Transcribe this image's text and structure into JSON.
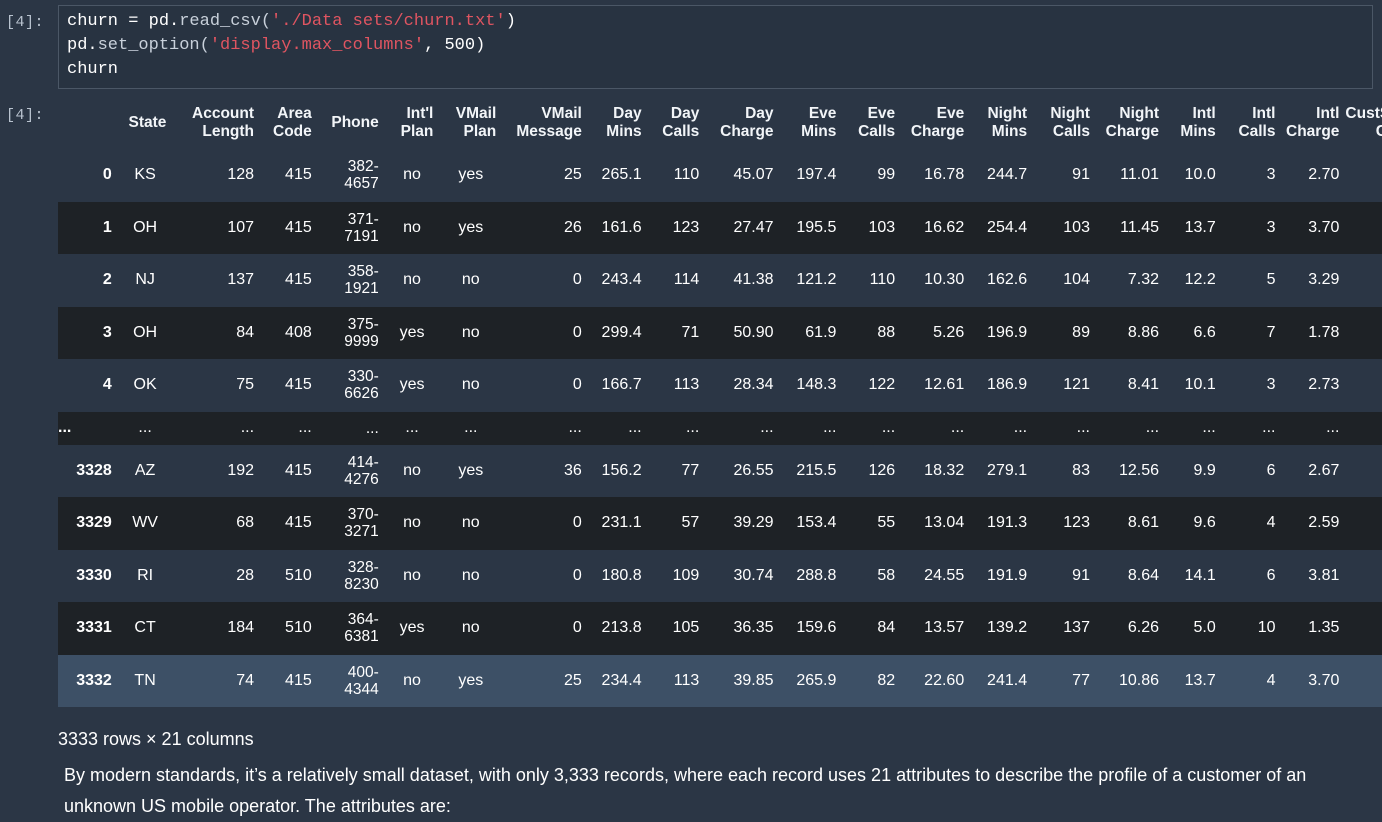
{
  "cell": {
    "in_prompt": "[4]:",
    "out_prompt": "[4]:",
    "code": [
      [
        {
          "t": "churn = pd.",
          "c": ""
        },
        {
          "t": "read_csv(",
          "c": "fn"
        },
        {
          "t": "'./Data sets/churn.txt'",
          "c": "str"
        },
        {
          "t": ")",
          "c": ""
        }
      ],
      [
        {
          "t": "pd.",
          "c": ""
        },
        {
          "t": "set_option(",
          "c": "fn"
        },
        {
          "t": "'display.max_columns'",
          "c": "str"
        },
        {
          "t": ", 500)",
          "c": ""
        }
      ],
      [
        {
          "t": "churn",
          "c": ""
        }
      ]
    ]
  },
  "table": {
    "columns": [
      "",
      "State",
      "Account Length",
      "Area Code",
      "Phone",
      "Int'l Plan",
      "VMail Plan",
      "VMail Message",
      "Day Mins",
      "Day Calls",
      "Day Charge",
      "Eve Mins",
      "Eve Calls",
      "Eve Charge",
      "Night Mins",
      "Night Calls",
      "Night Charge",
      "Intl Mins",
      "Intl Calls",
      "Intl Charge",
      "CustS C"
    ],
    "rows": [
      [
        "0",
        "KS",
        "128",
        "415",
        "382-4657",
        "no",
        "yes",
        "25",
        "265.1",
        "110",
        "45.07",
        "197.4",
        "99",
        "16.78",
        "244.7",
        "91",
        "11.01",
        "10.0",
        "3",
        "2.70",
        ""
      ],
      [
        "1",
        "OH",
        "107",
        "415",
        "371-7191",
        "no",
        "yes",
        "26",
        "161.6",
        "123",
        "27.47",
        "195.5",
        "103",
        "16.62",
        "254.4",
        "103",
        "11.45",
        "13.7",
        "3",
        "3.70",
        ""
      ],
      [
        "2",
        "NJ",
        "137",
        "415",
        "358-1921",
        "no",
        "no",
        "0",
        "243.4",
        "114",
        "41.38",
        "121.2",
        "110",
        "10.30",
        "162.6",
        "104",
        "7.32",
        "12.2",
        "5",
        "3.29",
        ""
      ],
      [
        "3",
        "OH",
        "84",
        "408",
        "375-9999",
        "yes",
        "no",
        "0",
        "299.4",
        "71",
        "50.90",
        "61.9",
        "88",
        "5.26",
        "196.9",
        "89",
        "8.86",
        "6.6",
        "7",
        "1.78",
        ""
      ],
      [
        "4",
        "OK",
        "75",
        "415",
        "330-6626",
        "yes",
        "no",
        "0",
        "166.7",
        "113",
        "28.34",
        "148.3",
        "122",
        "12.61",
        "186.9",
        "121",
        "8.41",
        "10.1",
        "3",
        "2.73",
        ""
      ],
      [
        "...",
        "...",
        "...",
        "...",
        "...",
        "...",
        "...",
        "...",
        "...",
        "...",
        "...",
        "...",
        "...",
        "...",
        "...",
        "...",
        "...",
        "...",
        "...",
        "...",
        ""
      ],
      [
        "3328",
        "AZ",
        "192",
        "415",
        "414-4276",
        "no",
        "yes",
        "36",
        "156.2",
        "77",
        "26.55",
        "215.5",
        "126",
        "18.32",
        "279.1",
        "83",
        "12.56",
        "9.9",
        "6",
        "2.67",
        ""
      ],
      [
        "3329",
        "WV",
        "68",
        "415",
        "370-3271",
        "no",
        "no",
        "0",
        "231.1",
        "57",
        "39.29",
        "153.4",
        "55",
        "13.04",
        "191.3",
        "123",
        "8.61",
        "9.6",
        "4",
        "2.59",
        ""
      ],
      [
        "3330",
        "RI",
        "28",
        "510",
        "328-8230",
        "no",
        "no",
        "0",
        "180.8",
        "109",
        "30.74",
        "288.8",
        "58",
        "24.55",
        "191.9",
        "91",
        "8.64",
        "14.1",
        "6",
        "3.81",
        ""
      ],
      [
        "3331",
        "CT",
        "184",
        "510",
        "364-6381",
        "yes",
        "no",
        "0",
        "213.8",
        "105",
        "36.35",
        "159.6",
        "84",
        "13.57",
        "139.2",
        "137",
        "6.26",
        "5.0",
        "10",
        "1.35",
        ""
      ],
      [
        "3332",
        "TN",
        "74",
        "415",
        "400-4344",
        "no",
        "yes",
        "25",
        "234.4",
        "113",
        "39.85",
        "265.9",
        "82",
        "22.60",
        "241.4",
        "77",
        "10.86",
        "13.7",
        "4",
        "3.70",
        ""
      ]
    ]
  },
  "rows_info": "3333 rows × 21 columns",
  "paragraph": "By modern standards, it’s a relatively small dataset, with only 3,333 records, where each record uses 21 attributes to describe the profile of a customer of an unknown US mobile operator. The attributes are:"
}
